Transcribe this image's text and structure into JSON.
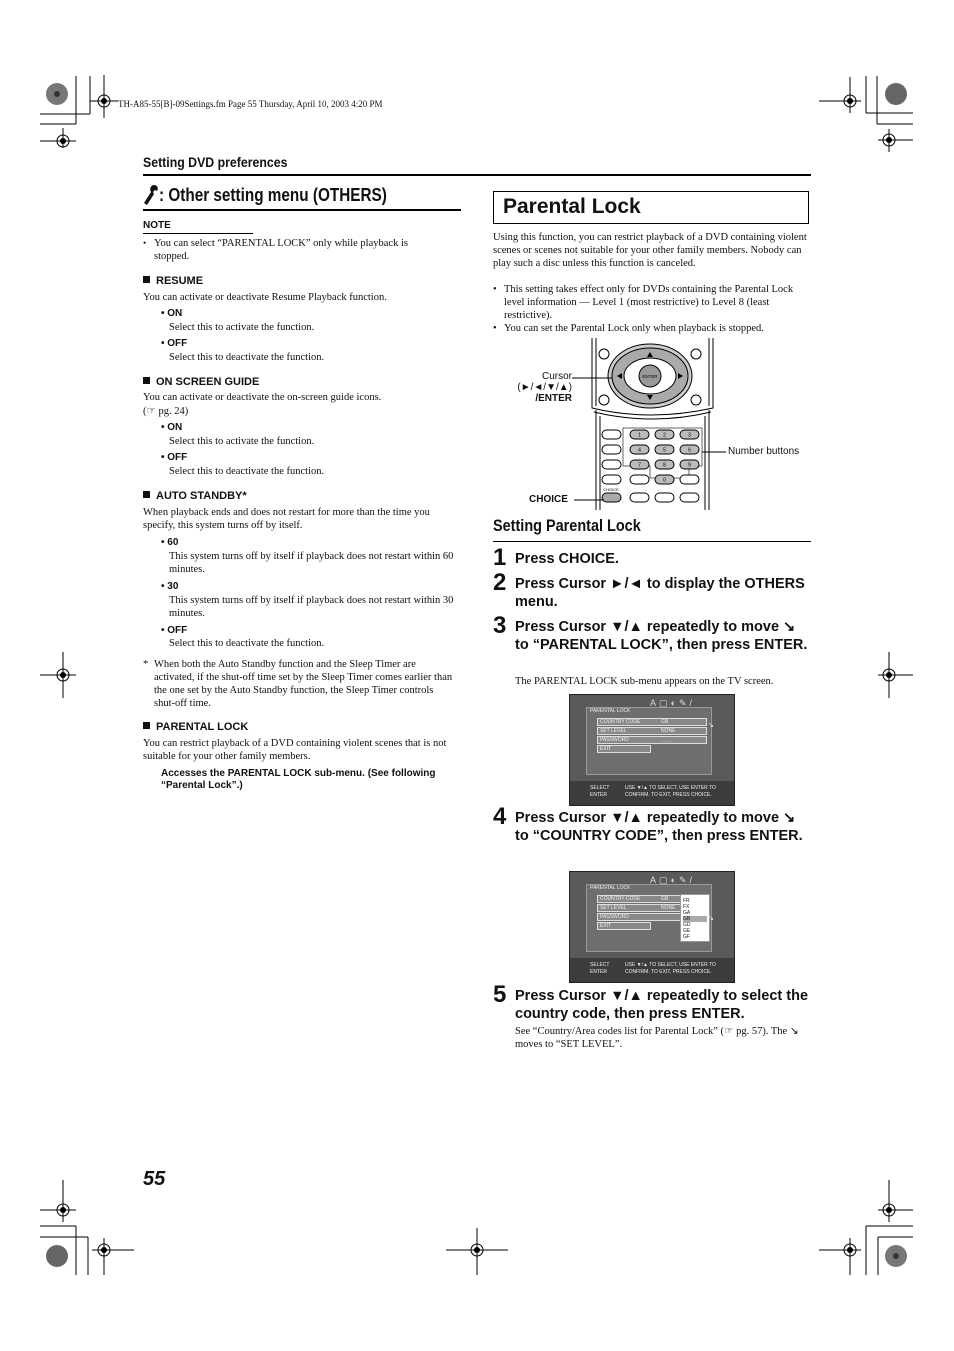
{
  "meta_line": "TH-A85-55[B]-09Settings.fm  Page 55  Thursday, April 10, 2003  4:20 PM",
  "section_header": "Setting DVD preferences",
  "others": {
    "icon": "wrench-icon",
    "title": ": Other setting menu (OTHERS)",
    "note_label": "NOTE",
    "note_text": "You can select “PARENTAL LOCK” only while playback is stopped.",
    "sections": [
      {
        "title": "RESUME",
        "desc": "You can activate or deactivate Resume Playback function.",
        "options": [
          {
            "label": "ON",
            "desc": "Select this to activate the function."
          },
          {
            "label": "OFF",
            "desc": "Select this to deactivate the function."
          }
        ]
      },
      {
        "title": "ON SCREEN GUIDE",
        "desc": "You can activate or deactivate the on-screen guide icons.",
        "ref": "(☞ pg. 24)",
        "options": [
          {
            "label": "ON",
            "desc": "Select this to activate the function."
          },
          {
            "label": "OFF",
            "desc": "Select this to deactivate the function."
          }
        ]
      },
      {
        "title": "AUTO STANDBY*",
        "desc": "When playback ends and does not restart for more than the time you specify, this system turns off by itself.",
        "options": [
          {
            "label": "60",
            "desc": "This system turns off by itself if playback does not restart within 60 minutes."
          },
          {
            "label": "30",
            "desc": "This system turns off by itself if playback does not restart within 30 minutes."
          },
          {
            "label": "OFF",
            "desc": "Select this to deactivate the function."
          }
        ],
        "footnote": "When both the Auto Standby function and the Sleep Timer are activated, if the shut-off time set by the Sleep Timer comes earlier than the one set by the Auto Standby function, the Sleep Timer controls shut-off time."
      },
      {
        "title": "PARENTAL LOCK",
        "desc": "You can restrict playback of a DVD containing violent scenes that is not suitable for your other family members.",
        "action": "Accesses the PARENTAL LOCK sub-menu. (See following “Parental Lock”.)"
      }
    ]
  },
  "parental": {
    "title": "Parental Lock",
    "intro": "Using this function, you can restrict playback of a DVD containing violent scenes or scenes not suitable for your other family members. Nobody can play such a disc unless this function is canceled.",
    "bullets": [
      "This setting takes effect only for DVDs containing the Parental Lock level information — Level 1 (most restrictive) to Level 8 (least restrictive).",
      "You can set the Parental Lock only when playback is stopped."
    ],
    "remote": {
      "cursor_label": "Cursor",
      "cursor_keys": "(►/◄/▼/▲)",
      "enter_label": "/ENTER",
      "number_label": "Number buttons",
      "choice_label": "CHOICE",
      "enter_btn": "ENTER",
      "choice_btn": "CHOICE",
      "numbers": [
        "1",
        "2",
        "3",
        "4",
        "5",
        "6",
        "7",
        "8",
        "9",
        "0"
      ]
    },
    "setting_title": "Setting Parental Lock",
    "steps": [
      {
        "num": "1",
        "text": "Press CHOICE."
      },
      {
        "num": "2",
        "text": "Press Cursor ►/◄ to display the OTHERS menu."
      },
      {
        "num": "3",
        "text": "Press Cursor ▼/▲ repeatedly to move ↘ to “PARENTAL LOCK”, then press ENTER.",
        "sub": "The PARENTAL LOCK sub-menu appears on the TV screen."
      },
      {
        "num": "4",
        "text": "Press Cursor ▼/▲ repeatedly to move ↘ to “COUNTRY CODE”, then press ENTER."
      },
      {
        "num": "5",
        "text": "Press Cursor ▼/▲ repeatedly to select the country code, then press ENTER.",
        "sub": "See “Country/Area codes list for Parental Lock” (☞ pg. 57). The ↘ moves to “SET LEVEL”."
      }
    ],
    "screen": {
      "title": "PARENTAL LOCK",
      "rows": [
        {
          "label": "COUNTRY CODE",
          "value": "GB"
        },
        {
          "label": "SET LEVEL",
          "value": "NONE"
        },
        {
          "label": "PASSWORD",
          "value": "- - - -"
        },
        {
          "label": "EXIT",
          "value": ""
        }
      ],
      "footer_left_1": "SELECT",
      "footer_left_2": "ENTER",
      "footer_msg": "USE ▼/▲ TO SELECT, USE ENTER TO CONFIRM. TO EXIT, PRESS CHOICE.",
      "dropdown": [
        "FR",
        "FX",
        "GA",
        "GB",
        "GD",
        "GE",
        "GF"
      ],
      "dropdown_selected": "GB"
    }
  },
  "page_number": "55"
}
